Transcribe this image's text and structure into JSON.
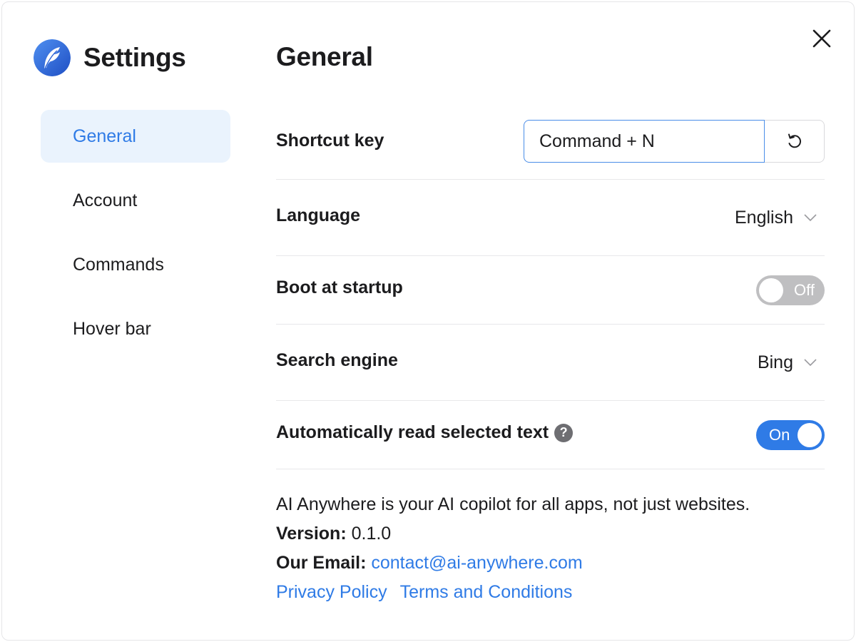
{
  "app": {
    "title": "Settings",
    "logo_icon": "feather-icon",
    "accent_color": "#2f7be6"
  },
  "sidebar": {
    "items": [
      {
        "label": "General",
        "active": true
      },
      {
        "label": "Account",
        "active": false
      },
      {
        "label": "Commands",
        "active": false
      },
      {
        "label": "Hover bar",
        "active": false
      }
    ]
  },
  "main": {
    "title": "General",
    "shortcut": {
      "label": "Shortcut key",
      "value": "Command + N",
      "reset_icon": "rotate-ccw-icon"
    },
    "language": {
      "label": "Language",
      "value": "English"
    },
    "boot": {
      "label": "Boot at startup",
      "state": "Off"
    },
    "search_engine": {
      "label": "Search engine",
      "value": "Bing"
    },
    "auto_read": {
      "label": "Automatically read selected text",
      "help": "?",
      "state": "On"
    }
  },
  "info": {
    "description": "AI Anywhere is your AI copilot for all apps, not just websites.",
    "version_label": "Version:",
    "version": "0.1.0",
    "email_label": "Our Email:",
    "email": "contact@ai-anywhere.com",
    "privacy": "Privacy Policy",
    "terms": "Terms and Conditions"
  }
}
